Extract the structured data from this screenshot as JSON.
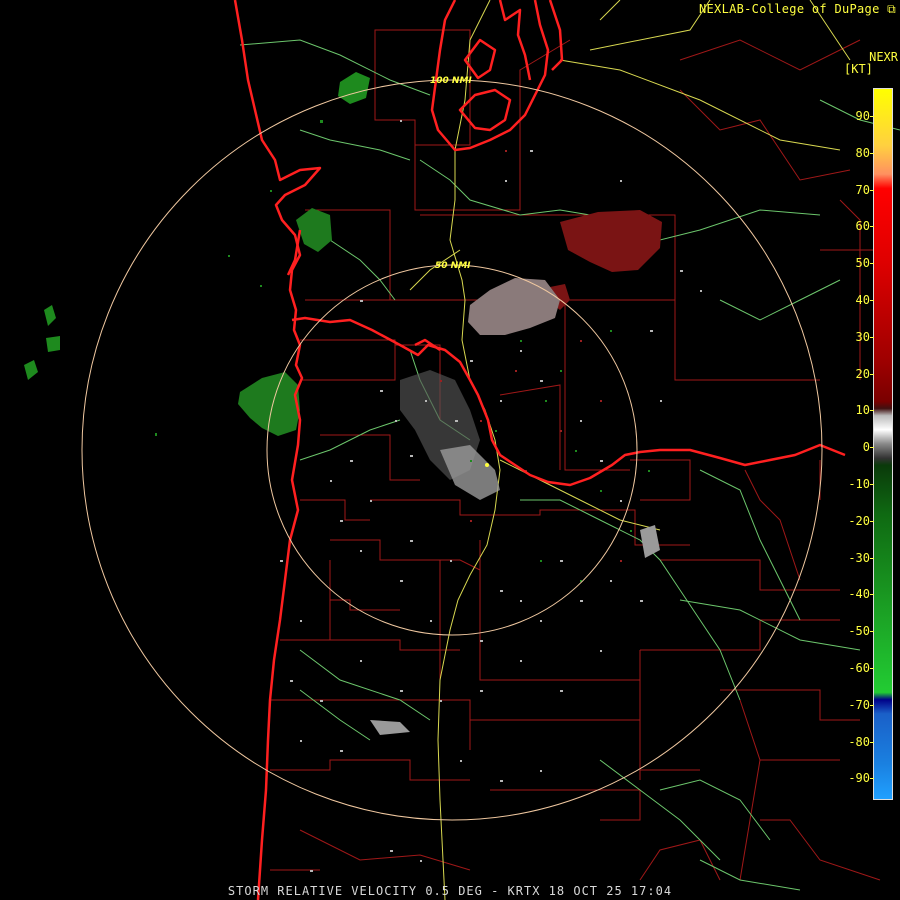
{
  "header": {
    "credit": "NEXLAB-College of DuPage",
    "product_abbrev": "NEXR",
    "units": "[KT]"
  },
  "rings": [
    {
      "label": "100 NMI"
    },
    {
      "label": "50 NMI"
    }
  ],
  "legend": {
    "ticks": [
      "90",
      "80",
      "70",
      "60",
      "50",
      "40",
      "30",
      "20",
      "10",
      "0",
      "-10",
      "-20",
      "-30",
      "-40",
      "-50",
      "-60",
      "-70",
      "-80",
      "-90"
    ],
    "colors": {
      "outbound_high": "#ffff00",
      "outbound_mid": "#ff0000",
      "outbound_low": "#7a0000",
      "near_zero": "#9a9a9a",
      "inbound_low": "#0f6a12",
      "inbound_mid": "#22cc33",
      "inbound_high": "#1a60c8"
    }
  },
  "map_colors": {
    "coast": "#ff2020",
    "county": "#b02020",
    "highway": "#e0e060",
    "river": "#70d070",
    "ring": "#f0c8a0"
  },
  "footer": "STORM RELATIVE VELOCITY 0.5 DEG - KRTX 18 OCT 25 17:04"
}
